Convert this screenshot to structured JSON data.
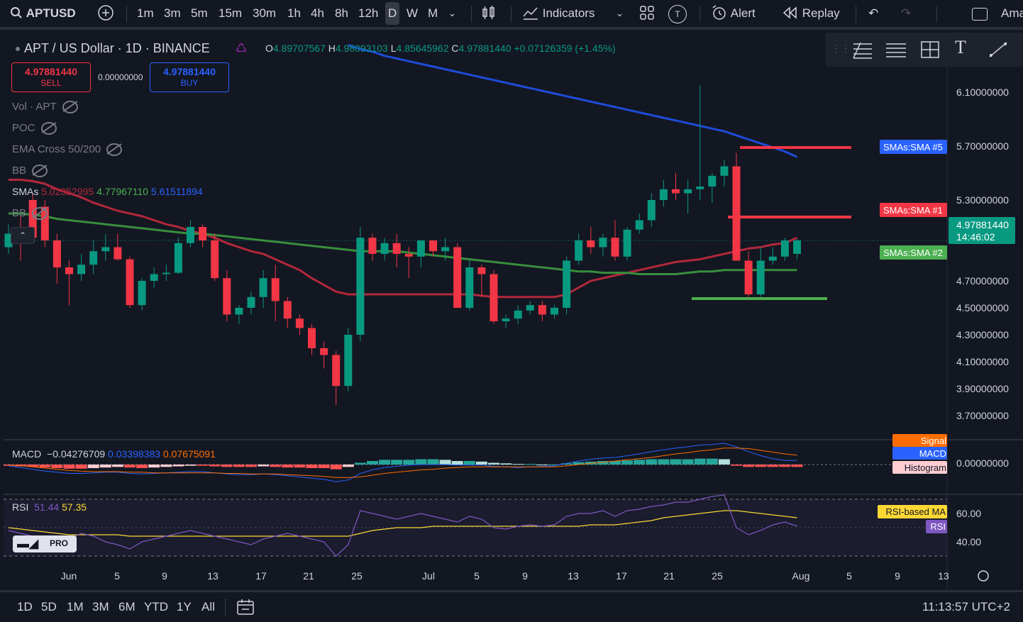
{
  "toolbar": {
    "symbol": "APTUSD",
    "timeframes": [
      "1m",
      "3m",
      "5m",
      "15m",
      "30m",
      "1h",
      "4h",
      "8h",
      "12h",
      "D",
      "W",
      "M"
    ],
    "active_timeframe": "D",
    "indicators_label": "Indicators",
    "alert_label": "Alert",
    "replay_label": "Replay",
    "badge_letter": "T",
    "cut_off_label": "Ama"
  },
  "header": {
    "title": "APT / US Dollar · 1D · BINANCE",
    "ohlc": {
      "o_key": "O",
      "o": "4.89707567",
      "h_key": "H",
      "h": "4.98093103",
      "l_key": "L",
      "l": "4.85645962",
      "c_key": "C",
      "c": "4.97881440",
      "change": "+0.07126359 (+1.45%)"
    }
  },
  "trade": {
    "sell_price": "4.97881440",
    "sell_label": "SELL",
    "spread": "0.00000000",
    "buy_price": "4.97881440",
    "buy_label": "BUY"
  },
  "legends": {
    "vol": "Vol · APT",
    "poc": "POC",
    "ema": "EMA Cross 50/200",
    "bb1": "BB",
    "smas_name": "SMAs",
    "smas_v1": "5.02352995",
    "smas_v2": "4.77967110",
    "smas_v3": "5.61511894",
    "bb2": "BB",
    "macd_name": "MACD",
    "macd_v1": "−0.04276709",
    "macd_v2": "0.03398383",
    "macd_v3": "0.07675091",
    "rsi_name": "RSI",
    "rsi_v1": "51.44",
    "rsi_v2": "57.35"
  },
  "colors": {
    "bg": "#131722",
    "up": "#089981",
    "down": "#f23645",
    "sma1": "#b2283b",
    "sma2": "#388e3c",
    "sma5": "#1e4bd8",
    "macd": "#2962ff",
    "signal": "#ff6d00",
    "rsi": "#7e57c2",
    "rsi_ma": "#fdd835"
  },
  "chart_data": [
    {
      "type": "candlestick",
      "title": "APT / US Dollar · 1D · BINANCE",
      "y_ticks": [
        "6.10000000",
        "5.70000000",
        "5.30000000",
        "4.70000000",
        "4.50000000",
        "4.30000000",
        "4.10000000",
        "3.90000000",
        "3.70000000"
      ],
      "x_ticks": [
        "Jun",
        "5",
        "9",
        "13",
        "17",
        "21",
        "25",
        "Jul",
        "5",
        "9",
        "13",
        "17",
        "21",
        "25",
        "Aug",
        "5",
        "9",
        "13"
      ],
      "ohlc": [
        [
          4.95,
          5.12,
          4.9,
          5.05
        ],
        [
          5.05,
          5.18,
          4.85,
          5.0
        ],
        [
          5.3,
          5.35,
          4.98,
          5.02
        ],
        [
          5.25,
          5.3,
          4.95,
          5.0
        ],
        [
          5.0,
          5.05,
          4.68,
          4.8
        ],
        [
          4.8,
          4.85,
          4.52,
          4.75
        ],
        [
          4.75,
          4.9,
          4.7,
          4.82
        ],
        [
          4.82,
          5.0,
          4.75,
          4.92
        ],
        [
          4.92,
          5.05,
          4.85,
          4.95
        ],
        [
          4.95,
          5.05,
          4.85,
          4.86
        ],
        [
          4.86,
          4.88,
          4.5,
          4.52
        ],
        [
          4.52,
          4.72,
          4.48,
          4.7
        ],
        [
          4.7,
          4.8,
          4.65,
          4.75
        ],
        [
          4.75,
          4.82,
          4.7,
          4.76
        ],
        [
          4.76,
          5.02,
          4.75,
          4.98
        ],
        [
          4.98,
          5.15,
          4.95,
          5.1
        ],
        [
          5.1,
          5.12,
          4.95,
          5.0
        ],
        [
          5.0,
          5.05,
          4.7,
          4.72
        ],
        [
          4.72,
          4.78,
          4.4,
          4.45
        ],
        [
          4.45,
          4.52,
          4.38,
          4.5
        ],
        [
          4.5,
          4.62,
          4.45,
          4.58
        ],
        [
          4.58,
          4.78,
          4.5,
          4.72
        ],
        [
          4.72,
          4.82,
          4.4,
          4.55
        ],
        [
          4.55,
          4.58,
          4.35,
          4.42
        ],
        [
          4.42,
          4.45,
          4.3,
          4.35
        ],
        [
          4.35,
          4.38,
          4.15,
          4.2
        ],
        [
          4.2,
          4.25,
          4.05,
          4.15
        ],
        [
          4.15,
          4.18,
          3.78,
          3.92
        ],
        [
          3.92,
          4.35,
          3.88,
          4.3
        ],
        [
          4.3,
          5.1,
          4.25,
          5.02
        ],
        [
          5.02,
          5.05,
          4.85,
          4.9
        ],
        [
          4.9,
          5.02,
          4.85,
          4.98
        ],
        [
          4.98,
          5.05,
          4.8,
          4.9
        ],
        [
          4.9,
          4.95,
          4.72,
          4.88
        ],
        [
          4.88,
          5.0,
          4.8,
          5.0
        ],
        [
          5.0,
          5.0,
          4.88,
          4.92
        ],
        [
          4.92,
          5.02,
          4.85,
          4.95
        ],
        [
          4.95,
          4.98,
          4.5,
          4.5
        ],
        [
          4.5,
          4.85,
          4.48,
          4.8
        ],
        [
          4.8,
          4.82,
          4.58,
          4.75
        ],
        [
          4.75,
          4.78,
          4.38,
          4.4
        ],
        [
          4.4,
          4.45,
          4.35,
          4.42
        ],
        [
          4.42,
          4.52,
          4.38,
          4.48
        ],
        [
          4.48,
          4.55,
          4.45,
          4.52
        ],
        [
          4.52,
          4.55,
          4.4,
          4.45
        ],
        [
          4.45,
          4.52,
          4.42,
          4.5
        ],
        [
          4.5,
          4.88,
          4.45,
          4.85
        ],
        [
          4.85,
          5.05,
          4.82,
          5.0
        ],
        [
          5.0,
          5.1,
          4.9,
          4.95
        ],
        [
          4.95,
          5.05,
          4.88,
          5.02
        ],
        [
          5.02,
          5.15,
          4.85,
          4.88
        ],
        [
          4.88,
          5.1,
          4.85,
          5.08
        ],
        [
          5.08,
          5.2,
          5.05,
          5.15
        ],
        [
          5.15,
          5.35,
          5.1,
          5.3
        ],
        [
          5.3,
          5.45,
          5.25,
          5.38
        ],
        [
          5.38,
          5.5,
          5.3,
          5.35
        ],
        [
          5.35,
          5.45,
          5.2,
          5.38
        ],
        [
          5.38,
          6.15,
          5.3,
          5.4
        ],
        [
          5.4,
          5.5,
          5.28,
          5.48
        ],
        [
          5.48,
          5.6,
          5.4,
          5.55
        ],
        [
          5.55,
          5.65,
          4.85,
          4.85
        ],
        [
          4.85,
          4.92,
          4.58,
          4.6
        ],
        [
          4.6,
          4.95,
          4.58,
          4.85
        ],
        [
          4.85,
          4.95,
          4.82,
          4.88
        ],
        [
          4.88,
          5.02,
          4.85,
          5.0
        ],
        [
          4.9,
          5.01,
          4.86,
          5.0
        ]
      ]
    },
    {
      "type": "line",
      "series": [
        {
          "name": "SMAs:SMA #1",
          "values": [
            5.45,
            5.45,
            5.44,
            5.42,
            5.38,
            5.35,
            5.32,
            5.28,
            5.25,
            5.22,
            5.2,
            5.18,
            5.15,
            5.12,
            5.1,
            5.07,
            5.05,
            5.02,
            4.98,
            4.95,
            4.92,
            4.9,
            4.86,
            4.82,
            4.78,
            4.72,
            4.67,
            4.62,
            4.6,
            4.6,
            4.6,
            4.6,
            4.6,
            4.6,
            4.6,
            4.6,
            4.6,
            4.6,
            4.6,
            4.59,
            4.58,
            4.58,
            4.58,
            4.58,
            4.58,
            4.58,
            4.6,
            4.65,
            4.7,
            4.72,
            4.74,
            4.76,
            4.78,
            4.8,
            4.82,
            4.84,
            4.85,
            4.86,
            4.88,
            4.9,
            4.92,
            4.94,
            4.95,
            4.97,
            4.98,
            5.02
          ]
        },
        {
          "name": "SMAs:SMA #2",
          "values": [
            5.2,
            5.2,
            5.19,
            5.18,
            5.16,
            5.15,
            5.14,
            5.13,
            5.12,
            5.11,
            5.1,
            5.09,
            5.08,
            5.07,
            5.06,
            5.05,
            5.05,
            5.04,
            5.03,
            5.02,
            5.01,
            5.0,
            4.99,
            4.98,
            4.97,
            4.96,
            4.95,
            4.94,
            4.93,
            4.92,
            4.92,
            4.92,
            4.92,
            4.91,
            4.9,
            4.89,
            4.88,
            4.87,
            4.86,
            4.85,
            4.84,
            4.83,
            4.82,
            4.81,
            4.8,
            4.79,
            4.78,
            4.77,
            4.77,
            4.76,
            4.76,
            4.76,
            4.75,
            4.75,
            4.75,
            4.75,
            4.76,
            4.77,
            4.77,
            4.78,
            4.78,
            4.78,
            4.78,
            4.78,
            4.78,
            4.78
          ]
        },
        {
          "name": "SMAs:SMA #5",
          "values": [
            null,
            null,
            null,
            null,
            null,
            null,
            null,
            null,
            null,
            null,
            null,
            null,
            null,
            null,
            null,
            null,
            null,
            null,
            null,
            null,
            null,
            null,
            null,
            null,
            null,
            null,
            null,
            null,
            6.45,
            6.42,
            6.4,
            6.37,
            6.35,
            6.33,
            6.31,
            6.29,
            6.27,
            6.25,
            6.23,
            6.21,
            6.19,
            6.17,
            6.15,
            6.13,
            6.11,
            6.09,
            6.07,
            6.05,
            6.03,
            6.01,
            5.99,
            5.97,
            5.95,
            5.93,
            5.91,
            5.89,
            5.87,
            5.85,
            5.83,
            5.81,
            5.78,
            5.75,
            5.72,
            5.69,
            5.66,
            5.62
          ]
        }
      ],
      "labels": [
        "SMAs:SMA #5",
        "SMAs:SMA #1",
        "SMAs:SMA #2"
      ],
      "last_price_label": "4.97881440",
      "countdown": "14:46:02"
    },
    {
      "type": "bar",
      "title": "MACD",
      "y_ticks": [
        "0.00000000"
      ],
      "histogram": [
        -0.02,
        -0.03,
        -0.04,
        -0.05,
        -0.06,
        -0.07,
        -0.07,
        -0.06,
        -0.05,
        -0.04,
        -0.05,
        -0.06,
        -0.05,
        -0.04,
        -0.03,
        -0.02,
        -0.02,
        -0.03,
        -0.04,
        -0.04,
        -0.04,
        -0.03,
        -0.04,
        -0.05,
        -0.05,
        -0.06,
        -0.06,
        -0.08,
        -0.04,
        0.03,
        0.06,
        0.08,
        0.08,
        0.08,
        0.09,
        0.09,
        0.08,
        0.06,
        0.06,
        0.05,
        0.03,
        0.02,
        0.01,
        0.01,
        0.0,
        0.0,
        0.02,
        0.04,
        0.05,
        0.06,
        0.06,
        0.07,
        0.08,
        0.09,
        0.09,
        0.09,
        0.09,
        0.1,
        0.1,
        0.09,
        -0.02,
        -0.04,
        -0.04,
        -0.04,
        -0.04,
        -0.04
      ],
      "macd": [
        -0.02,
        -0.05,
        -0.08,
        -0.11,
        -0.13,
        -0.15,
        -0.15,
        -0.14,
        -0.13,
        -0.13,
        -0.15,
        -0.16,
        -0.15,
        -0.14,
        -0.13,
        -0.12,
        -0.12,
        -0.14,
        -0.16,
        -0.17,
        -0.17,
        -0.16,
        -0.17,
        -0.19,
        -0.21,
        -0.23,
        -0.25,
        -0.29,
        -0.26,
        -0.15,
        -0.09,
        -0.05,
        -0.03,
        -0.01,
        0.0,
        0.0,
        0.0,
        -0.01,
        -0.01,
        -0.01,
        -0.03,
        -0.04,
        -0.05,
        -0.04,
        -0.03,
        -0.02,
        0.02,
        0.06,
        0.09,
        0.11,
        0.12,
        0.15,
        0.18,
        0.22,
        0.25,
        0.28,
        0.3,
        0.33,
        0.34,
        0.36,
        0.3,
        0.22,
        0.15,
        0.1,
        0.07,
        0.07
      ],
      "signal": [
        -0.01,
        -0.02,
        -0.04,
        -0.06,
        -0.08,
        -0.1,
        -0.11,
        -0.12,
        -0.12,
        -0.12,
        -0.13,
        -0.13,
        -0.14,
        -0.14,
        -0.14,
        -0.14,
        -0.14,
        -0.14,
        -0.15,
        -0.15,
        -0.16,
        -0.16,
        -0.16,
        -0.17,
        -0.18,
        -0.19,
        -0.2,
        -0.22,
        -0.22,
        -0.21,
        -0.18,
        -0.15,
        -0.13,
        -0.11,
        -0.09,
        -0.08,
        -0.06,
        -0.05,
        -0.04,
        -0.04,
        -0.04,
        -0.04,
        -0.04,
        -0.04,
        -0.04,
        -0.04,
        -0.02,
        0.0,
        0.02,
        0.04,
        0.06,
        0.08,
        0.1,
        0.12,
        0.15,
        0.18,
        0.2,
        0.23,
        0.25,
        0.28,
        0.28,
        0.27,
        0.24,
        0.21,
        0.18,
        0.16
      ],
      "labels": [
        "Signal",
        "MACD",
        "Histogram"
      ]
    },
    {
      "type": "line",
      "title": "RSI",
      "y_ticks": [
        "60.00",
        "40.00"
      ],
      "series": [
        {
          "name": "RSI",
          "values": [
            48,
            46,
            44,
            40,
            38,
            42,
            46,
            44,
            40,
            38,
            35,
            40,
            42,
            44,
            46,
            48,
            46,
            44,
            42,
            40,
            38,
            42,
            44,
            46,
            44,
            42,
            40,
            30,
            38,
            62,
            60,
            58,
            56,
            58,
            60,
            58,
            56,
            54,
            58,
            56,
            50,
            49,
            51,
            52,
            51,
            52,
            58,
            60,
            60,
            62,
            58,
            62,
            63,
            65,
            66,
            68,
            68,
            70,
            72,
            73,
            50,
            45,
            48,
            52,
            54,
            51
          ]
        },
        {
          "name": "RSI-based MA",
          "values": [
            50,
            49,
            48,
            47,
            46,
            45,
            45,
            45,
            45,
            45,
            44,
            44,
            44,
            44,
            44,
            44,
            44,
            44,
            44,
            44,
            44,
            44,
            44,
            44,
            44,
            44,
            44,
            44,
            44,
            46,
            48,
            49,
            50,
            50,
            50,
            51,
            51,
            51,
            51,
            51,
            51,
            51,
            51,
            51,
            51,
            51,
            51,
            51,
            52,
            52,
            52,
            53,
            54,
            55,
            57,
            58,
            59,
            60,
            61,
            62,
            62,
            61,
            60,
            59,
            58,
            57
          ]
        }
      ],
      "labels": [
        "RSI-based MA",
        "RSI"
      ]
    }
  ],
  "bottom": {
    "ranges": [
      "1D",
      "5D",
      "1M",
      "3M",
      "6M",
      "YTD",
      "1Y",
      "All"
    ],
    "clock": "11:13:57 UTC+2",
    "logo_text": "PRO"
  }
}
